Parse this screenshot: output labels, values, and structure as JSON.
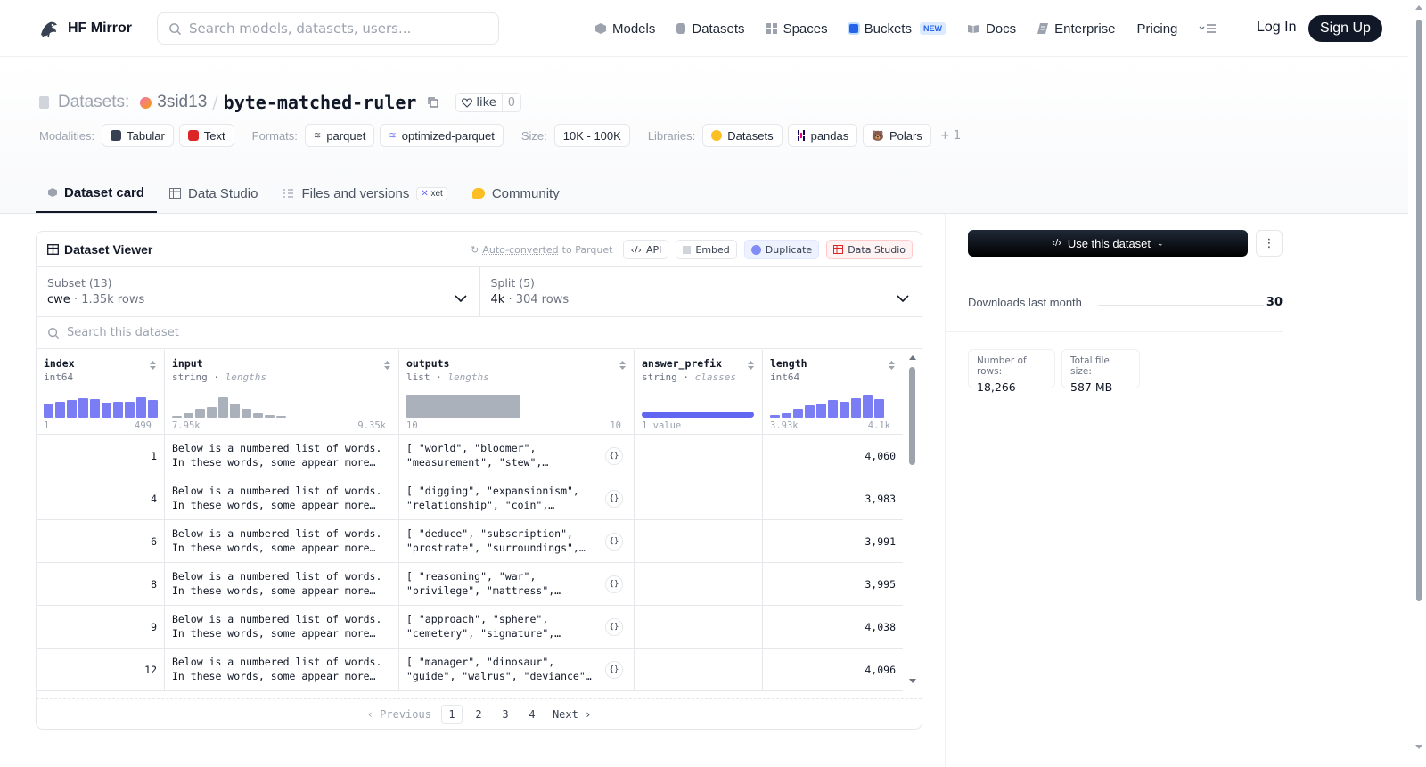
{
  "header": {
    "brand": "HF Mirror",
    "search_placeholder": "Search models, datasets, users...",
    "nav": [
      {
        "label": "Models",
        "icon": "models-icon",
        "color": "#9ca3af"
      },
      {
        "label": "Datasets",
        "icon": "datasets-icon",
        "color": "#9ca3af"
      },
      {
        "label": "Spaces",
        "icon": "spaces-icon",
        "color": "#9ca3af"
      },
      {
        "label": "Buckets",
        "icon": "buckets-icon",
        "color": "#2563eb",
        "badge": "NEW"
      },
      {
        "label": "Docs",
        "icon": "docs-icon",
        "color": "#9ca3af"
      },
      {
        "label": "Enterprise",
        "icon": "enterprise-icon",
        "color": "#9ca3af"
      },
      {
        "label": "Pricing"
      }
    ],
    "login": "Log In",
    "signup": "Sign Up"
  },
  "dataset": {
    "label": "Datasets:",
    "owner": "3sid13",
    "name": "byte-matched-ruler",
    "like_label": "like",
    "like_count": "0"
  },
  "meta": {
    "modalities_label": "Modalities:",
    "modalities": [
      "Tabular",
      "Text"
    ],
    "formats_label": "Formats:",
    "formats": [
      "parquet",
      "optimized-parquet"
    ],
    "size_label": "Size:",
    "size": "10K - 100K",
    "libraries_label": "Libraries:",
    "libraries": [
      "Datasets",
      "pandas",
      "Polars"
    ],
    "more_libraries": "+ 1"
  },
  "tabs": [
    {
      "label": "Dataset card",
      "icon": "dataset-card-icon",
      "active": true
    },
    {
      "label": "Data Studio",
      "icon": "table-icon"
    },
    {
      "label": "Files and versions",
      "icon": "files-icon",
      "badge": "xet"
    },
    {
      "label": "Community",
      "icon": "community-icon"
    }
  ],
  "viewer": {
    "title": "Dataset Viewer",
    "auto_converted_link": "Auto-converted",
    "auto_converted_suffix": "to Parquet",
    "actions": {
      "api": "API",
      "embed": "Embed",
      "duplicate": "Duplicate",
      "data_studio": "Data Studio"
    },
    "subset": {
      "label": "Subset (13)",
      "value": "cwe",
      "rows": "1.35k rows"
    },
    "split": {
      "label": "Split (5)",
      "value": "4k",
      "rows": "304 rows"
    },
    "search_placeholder": "Search this dataset",
    "columns": [
      {
        "name": "index",
        "type": "int64",
        "stat": "",
        "min": "1",
        "max": "499",
        "hist": [
          0.6,
          0.7,
          0.75,
          0.85,
          0.8,
          0.65,
          0.7,
          0.7,
          0.9,
          0.75
        ],
        "hist_style": "bars"
      },
      {
        "name": "input",
        "type": "string",
        "stat": "lengths",
        "min": "7.95k",
        "max": "9.35k",
        "hist": [
          0.05,
          0.2,
          0.4,
          0.45,
          0.9,
          0.6,
          0.4,
          0.2,
          0.1,
          0.05
        ],
        "hist_style": "gray"
      },
      {
        "name": "outputs",
        "type": "list",
        "stat": "lengths",
        "min": "10",
        "max": "10",
        "hist": [
          1.0
        ],
        "hist_style": "gray-block"
      },
      {
        "name": "answer_prefix",
        "type": "string",
        "stat": "classes",
        "min": "1 value",
        "max": "",
        "hist": [
          1.0
        ],
        "hist_style": "class"
      },
      {
        "name": "length",
        "type": "int64",
        "stat": "",
        "min": "3.93k",
        "max": "4.1k",
        "hist": [
          0.1,
          0.2,
          0.4,
          0.55,
          0.6,
          0.75,
          0.7,
          0.85,
          1.0,
          0.8
        ],
        "hist_style": "bars"
      }
    ],
    "rows": [
      {
        "index": "1",
        "input_l1": "Below is a numbered list of words.",
        "input_l2": "In these words, some appear more…",
        "out_l1": "[ \"world\", \"bloomer\",",
        "out_l2": "\"measurement\", \"stew\",…",
        "answer_prefix": "",
        "length": "4,060"
      },
      {
        "index": "4",
        "input_l1": "Below is a numbered list of words.",
        "input_l2": "In these words, some appear more…",
        "out_l1": "[ \"digging\", \"expansionism\",",
        "out_l2": "\"relationship\", \"coin\",…",
        "answer_prefix": "",
        "length": "3,983"
      },
      {
        "index": "6",
        "input_l1": "Below is a numbered list of words.",
        "input_l2": "In these words, some appear more…",
        "out_l1": "[ \"deduce\", \"subscription\",",
        "out_l2": "\"prostrate\", \"surroundings\",…",
        "answer_prefix": "",
        "length": "3,991"
      },
      {
        "index": "8",
        "input_l1": "Below is a numbered list of words.",
        "input_l2": "In these words, some appear more…",
        "out_l1": "[ \"reasoning\", \"war\",",
        "out_l2": "\"privilege\", \"mattress\",…",
        "answer_prefix": "",
        "length": "3,995"
      },
      {
        "index": "9",
        "input_l1": "Below is a numbered list of words.",
        "input_l2": "In these words, some appear more…",
        "out_l1": "[ \"approach\", \"sphere\",",
        "out_l2": "\"cemetery\", \"signature\",…",
        "answer_prefix": "",
        "length": "4,038"
      },
      {
        "index": "12",
        "input_l1": "Below is a numbered list of words.",
        "input_l2": "In these words, some appear more…",
        "out_l1": "[ \"manager\", \"dinosaur\",",
        "out_l2": "\"guide\", \"walrus\", \"deviance\"…",
        "answer_prefix": "",
        "length": "4,096"
      }
    ],
    "pager": {
      "previous": "Previous",
      "pages": [
        "1",
        "2",
        "3",
        "4"
      ],
      "current": "1",
      "next": "Next"
    }
  },
  "side": {
    "use_dataset": "Use this dataset",
    "downloads_label": "Downloads last month",
    "downloads_value": "30",
    "num_rows_label": "Number of rows:",
    "num_rows": "18,266",
    "file_size_label": "Total file size:",
    "file_size": "587 MB"
  },
  "colors": {
    "accent": "#6366f1",
    "dark": "#111827",
    "border": "#e5e7eb"
  }
}
